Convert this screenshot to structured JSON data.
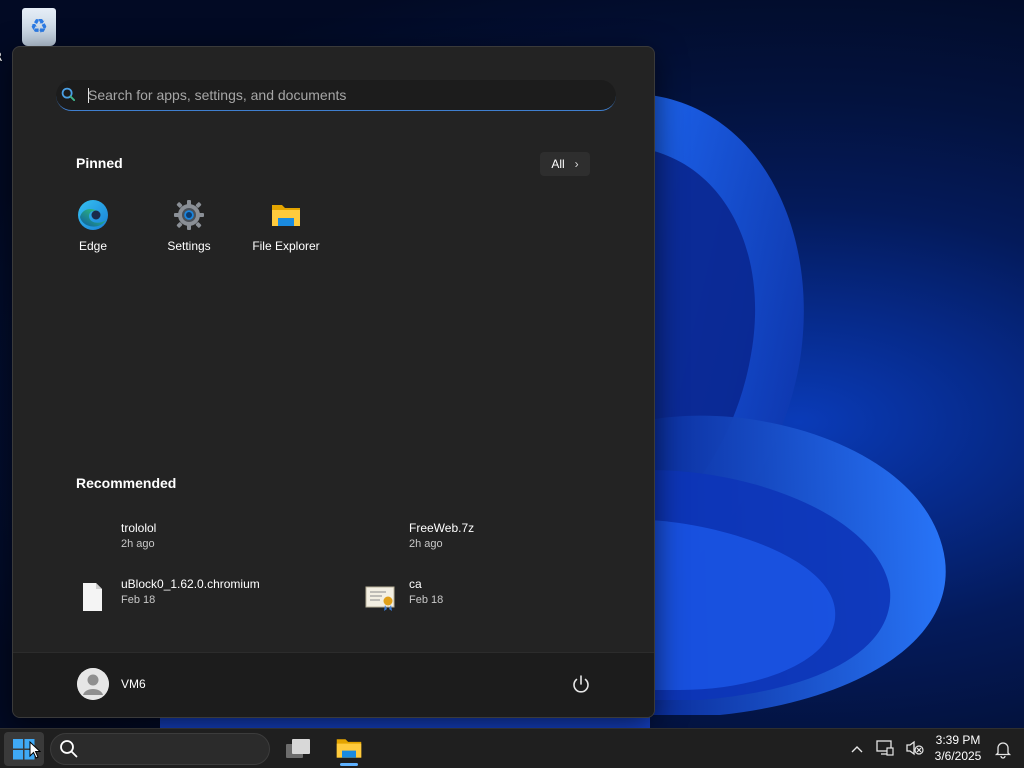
{
  "desktop": {
    "recycle_bin_label": "R"
  },
  "start_menu": {
    "search": {
      "placeholder": "Search for apps, settings, and documents",
      "value": ""
    },
    "pinned": {
      "title": "Pinned",
      "all_label": "All",
      "items": [
        {
          "label": "Edge",
          "icon": "edge-icon"
        },
        {
          "label": "Settings",
          "icon": "gear-icon"
        },
        {
          "label": "File Explorer",
          "icon": "folder-icon"
        }
      ]
    },
    "recommended": {
      "title": "Recommended",
      "items": [
        {
          "name": "trololol",
          "time": "2h ago",
          "icon": "none"
        },
        {
          "name": "FreeWeb.7z",
          "time": "2h ago",
          "icon": "none"
        },
        {
          "name": "uBlock0_1.62.0.chromium",
          "time": "Feb 18",
          "icon": "file-icon"
        },
        {
          "name": "ca",
          "time": "Feb 18",
          "icon": "certificate-icon"
        }
      ]
    },
    "user": {
      "name": "VM6"
    }
  },
  "taskbar": {
    "search_placeholder": "",
    "clock": {
      "time": "3:39 PM",
      "date": "3/6/2025"
    }
  },
  "colors": {
    "accent": "#3f7fcf",
    "menu_bg": "#232323",
    "taskbar_bg": "#1f1f1f"
  }
}
